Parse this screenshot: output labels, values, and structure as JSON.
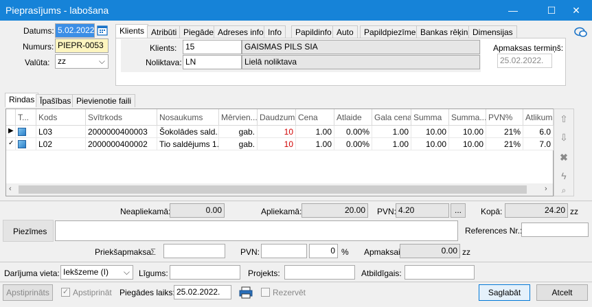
{
  "window": {
    "title": "Pieprasījums - labošana",
    "minimize": "—",
    "maximize": "☐",
    "close": "✕"
  },
  "header": {
    "datums_label": "Datums:",
    "datums_value": "5.02.2022.",
    "numurs_label": "Numurs:",
    "numurs_value": "PIEPR-0053",
    "valuta_label": "Valūta:",
    "valuta_value": "zz"
  },
  "top_tabs": [
    "Klients",
    "Atribūti",
    "Piegāde",
    "Adreses info",
    "Info",
    "Papildinfo",
    "Auto",
    "Papildpiezīmes",
    "Bankas rēķins",
    "Dimensijas"
  ],
  "client": {
    "klients_label": "Klients:",
    "klients_code": "15",
    "klients_name": "GAISMAS PILS SIA",
    "noliktava_label": "Noliktava:",
    "noliktava_code": "LN",
    "noliktava_name": "Lielā noliktava",
    "termins_label": "Apmaksas termiņš:",
    "termins_value": "25.02.2022."
  },
  "bottom_tabs": [
    "Rindas",
    "Īpašības",
    "Pievienotie faili"
  ],
  "table": {
    "columns": [
      "T...",
      "Kods",
      "Svītrkods",
      "Nosaukums",
      "Mērvien...",
      "Daudzums",
      "Cena",
      "Atlaide",
      "Gala cena",
      "Summa",
      "Summa...",
      "PVN%",
      "Atlikums"
    ],
    "rows": [
      {
        "marker": "▶",
        "kods": "L03",
        "svitrkods": "2000000400003",
        "nosaukums": "Šokolādes sald...",
        "merv": "gab.",
        "daudz": "10",
        "cena": "1.00",
        "atlaide": "0.00%",
        "gala": "1.00",
        "summa": "10.00",
        "summa2": "10.00",
        "pvn": "21%",
        "atlikums": "6.0"
      },
      {
        "marker": "✓",
        "kods": "L02",
        "svitrkods": "2000000400002",
        "nosaukums": "Tio saldējums 1...",
        "merv": "gab.",
        "daudz": "10",
        "cena": "1.00",
        "atlaide": "0.00%",
        "gala": "1.00",
        "summa": "10.00",
        "summa2": "10.00",
        "pvn": "21%",
        "atlikums": "7.0"
      }
    ]
  },
  "totals": {
    "neapliekama_label": "Neapliekamā:",
    "neapliekama_value": "0.00",
    "apliekama_label": "Apliekamā:",
    "apliekama_value": "20.00",
    "pvn_label": "PVN:",
    "pvn_value": "4.20",
    "pvn_btn": "...",
    "kopa_label": "Kopā:",
    "kopa_value": "24.20",
    "kopa_unit": "zz"
  },
  "notes": {
    "piezimes_label": "Piezīmes",
    "references_label": "References Nr.:"
  },
  "prepay": {
    "priekšapmaksa_label": "Priekšapmaksa:",
    "sigma": "Σ",
    "pvn_label": "PVN:",
    "pvn_pct": "0",
    "pct_sign": "%",
    "apmaksai_label": "Apmaksai:",
    "apmaksai_value": "0.00",
    "apmaksai_unit": "zz"
  },
  "deal": {
    "vieta_label": "Darījuma vieta:",
    "vieta_value": "Iekšzeme (I)",
    "ligums_label": "Līgums:",
    "projekts_label": "Projekts:",
    "atbildigais_label": "Atbildīgais:"
  },
  "footer": {
    "apstiprinats_btn": "Apstiprināts",
    "apstiprinat_label": "Apstiprināt",
    "piegades_label": "Piegādes laiks:",
    "piegades_value": "25.02.2022.",
    "rezervet_label": "Rezervēt",
    "save_btn": "Saglabāt",
    "cancel_btn": "Atcelt"
  }
}
